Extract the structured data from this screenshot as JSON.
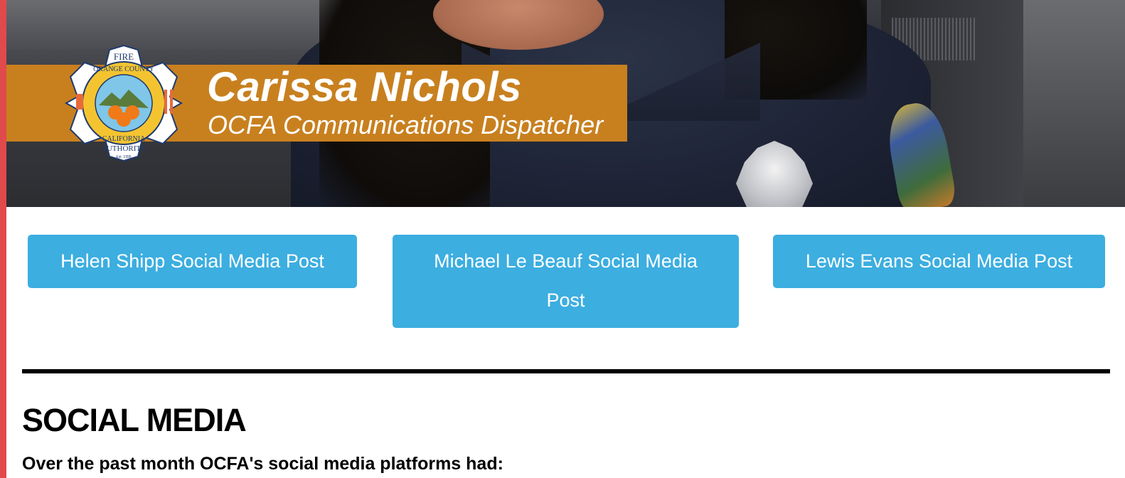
{
  "hero": {
    "name": "Carissa Nichols",
    "subtitle": "OCFA Communications Dispatcher",
    "logo": {
      "top_text": "FIRE",
      "ring_top": "ORANGE COUNTY",
      "ring_bottom": "CALIFORNIA",
      "bottom_text": "AUTHORITY",
      "est": "Est. 1995"
    }
  },
  "buttons": [
    {
      "label": "Helen Shipp Social Media Post"
    },
    {
      "label": "Michael Le Beauf Social Media Post"
    },
    {
      "label": "Lewis Evans Social Media Post"
    }
  ],
  "section": {
    "title": "SOCIAL MEDIA",
    "intro": "Over the past month OCFA's social media platforms had:"
  },
  "colors": {
    "accent_bar": "#e04a4c",
    "lower_third": "#c8801f",
    "button": "#3caee0"
  }
}
